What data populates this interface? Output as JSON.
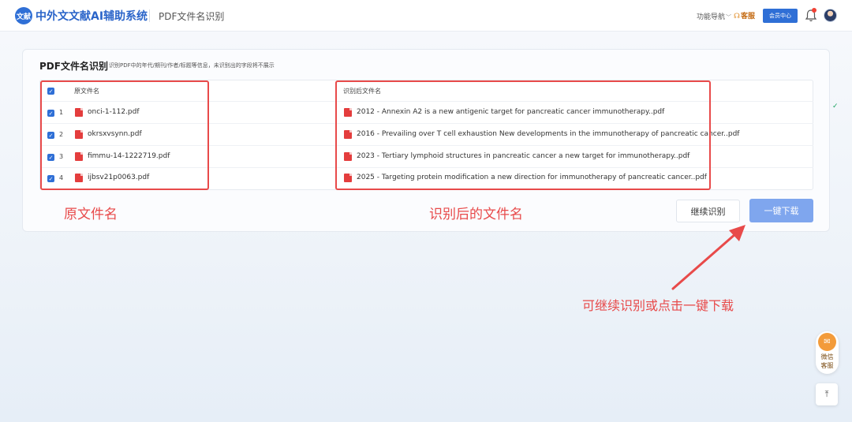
{
  "header": {
    "logo_text": "文献",
    "app_title": "中外文文献AI辅助系统",
    "page_name": "PDF文件名识别",
    "nav_menu_label": "功能导航",
    "customer_service_label": "客服",
    "member_center_label": "会员中心"
  },
  "panel": {
    "title": "PDF文件名识别",
    "subtitle": "识别PDF中的年代/期刊/作者/标题等信息，未识别出的字段将不展示"
  },
  "table": {
    "original_header": "原文件名",
    "renamed_header": "识别后文件名",
    "rows": [
      {
        "index": "1",
        "original": "onci-1-112.pdf",
        "renamed": "2012 - Annexin A2 is a new antigenic target for pancreatic cancer immunotherapy..pdf",
        "checked": true
      },
      {
        "index": "2",
        "original": "okrsxvsynn.pdf",
        "renamed": "2016 - Prevailing over T cell exhaustion New developments in the immunotherapy of pancreatic cancer..pdf",
        "checked": true
      },
      {
        "index": "3",
        "original": "fimmu-14-1222719.pdf",
        "renamed": "2023 - Tertiary lymphoid structures in pancreatic cancer a new target for immunotherapy..pdf",
        "checked": true
      },
      {
        "index": "4",
        "original": "ijbsv21p0063.pdf",
        "renamed": "2025 - Targeting protein modification a new direction for immunotherapy of pancreatic cancer..pdf",
        "checked": true
      }
    ]
  },
  "annotations": {
    "original_label": "原文件名",
    "renamed_label": "识别后的文件名",
    "hint": "可继续识别或点击一键下载"
  },
  "buttons": {
    "continue_label": "继续识别",
    "download_label": "一键下载"
  },
  "floating": {
    "wechat_label": "微信客服",
    "to_top_icon": "arrow-up-to-top"
  },
  "colors": {
    "brand": "#2f6fd6",
    "annotation_red": "#e84a4a",
    "download_button": "#7fa6ee"
  }
}
